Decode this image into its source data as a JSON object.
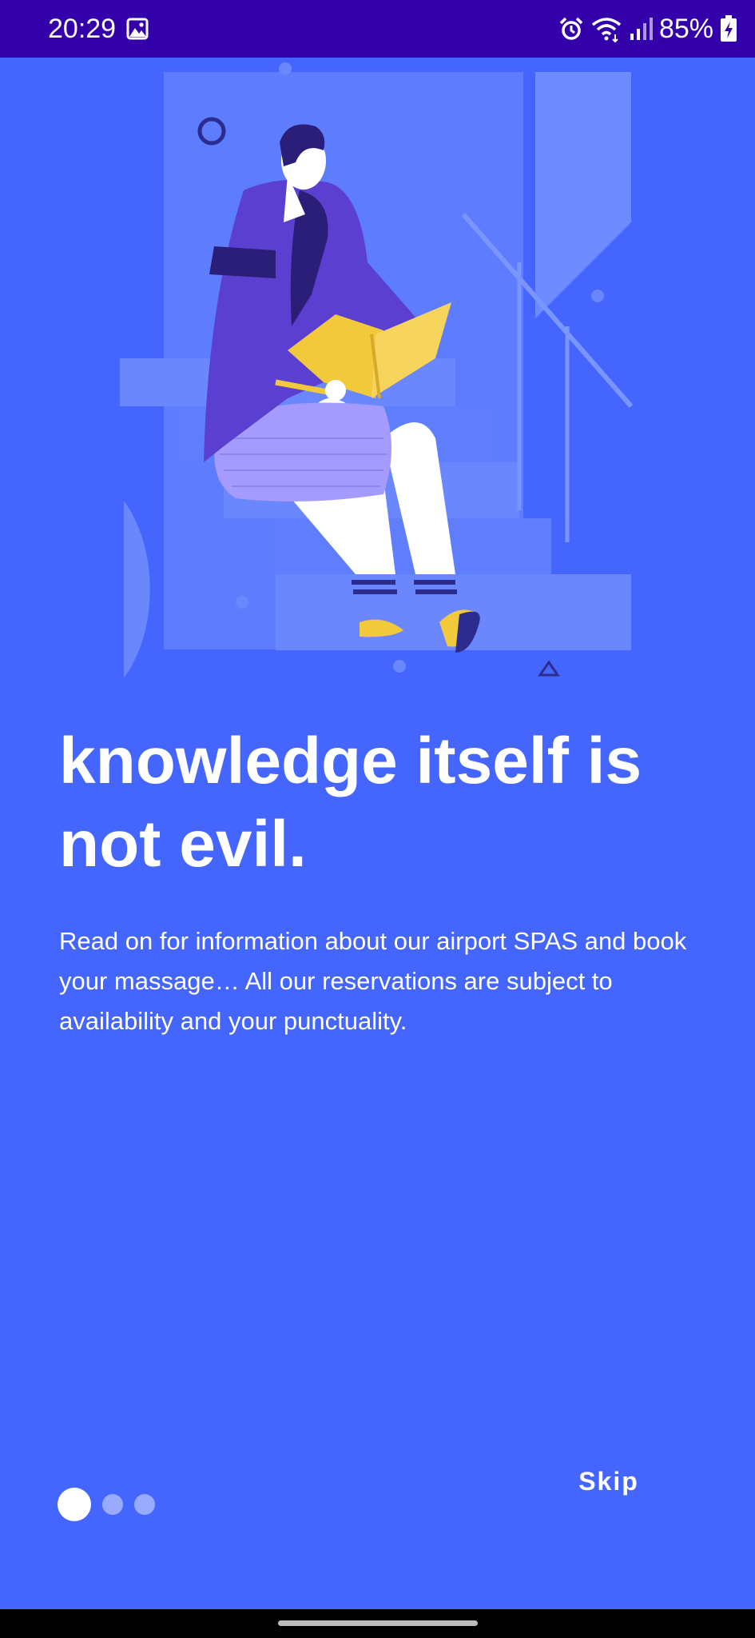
{
  "status_bar": {
    "time": "20:29",
    "battery": "85%",
    "icons": [
      "gallery-icon",
      "alarm-icon",
      "wifi-icon",
      "signal-icon",
      "battery-charging-icon"
    ]
  },
  "onboarding": {
    "illustration": "person-reading-book-on-stairs",
    "headline": "knowledge itself is not evil.",
    "body": "Read on for information about our airport SPAS and book your massage… All our reservations are subject to availability and your punctuality.",
    "page_indicator": {
      "current": 1,
      "total": 3
    },
    "skip_label": "Skip"
  },
  "colors": {
    "background": "#4466fe",
    "status_bar": "#3300aa",
    "text": "#ffffff",
    "book": "#f1c93b",
    "sweater": "#5b3fd1"
  }
}
